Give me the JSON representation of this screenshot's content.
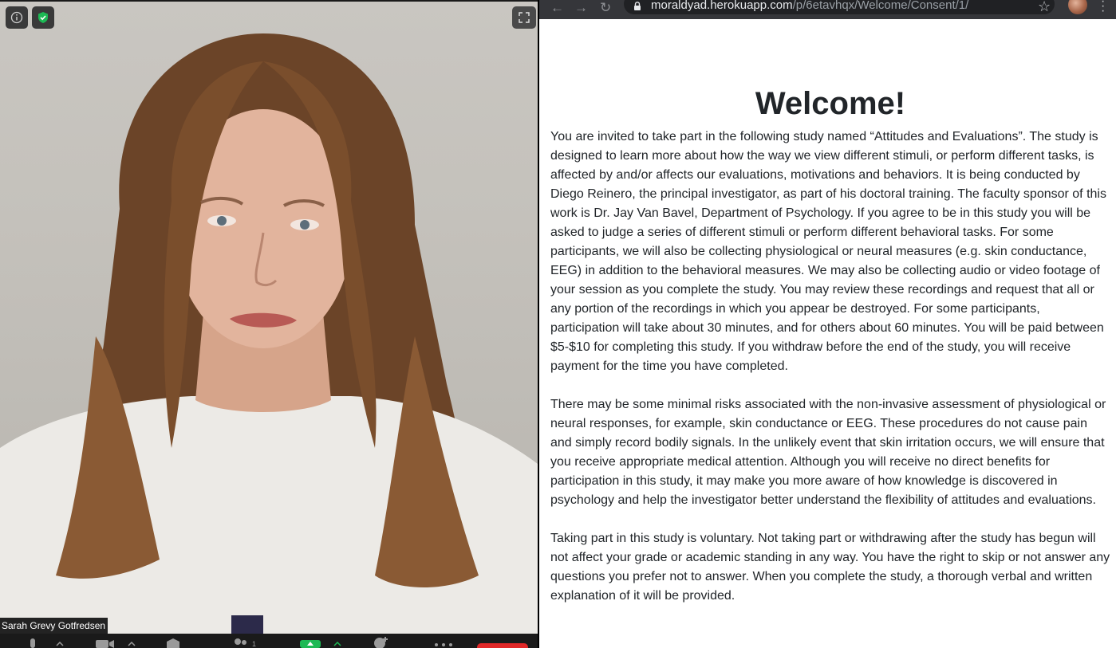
{
  "zoom": {
    "participant_name": "Sarah Grevy Gotfredsen",
    "icons": {
      "info": "info-icon",
      "security": "shield-check-icon",
      "fullscreen": "fullscreen-icon"
    },
    "colors": {
      "shield": "#1db954",
      "toolbar_bg": "#1a1a1a"
    },
    "toolbar": {
      "participants_count": "1"
    }
  },
  "browser": {
    "url_host": "moraldyad.herokuapp.com",
    "url_path": "/p/6etavhqx/Welcome/Consent/1/"
  },
  "page": {
    "title": "Welcome!",
    "paragraphs": [
      "You are invited to take part in the following study named “Attitudes and Evaluations”. The study is designed to learn more about how the way we view different stimuli, or perform different tasks, is affected by and/or affects our evaluations, motivations and behaviors. It is being conducted by Diego Reinero, the principal investigator, as part of his doctoral training. The faculty sponsor of this work is Dr. Jay Van Bavel, Department of Psychology. If you agree to be in this study you will be asked to judge a series of different stimuli or perform different behavioral tasks. For some participants, we will also be collecting physiological or neural measures (e.g. skin conductance, EEG) in addition to the behavioral measures. We may also be collecting audio or video footage of your session as you complete the study. You may review these recordings and request that all or any portion of the recordings in which you appear be destroyed. For some participants, participation will take about 30 minutes, and for others about 60 minutes. You will be paid between $5-$10 for completing this study. If you withdraw before the end of the study, you will receive payment for the time you have completed.",
      "There may be some minimal risks associated with the non-invasive assessment of physiological or neural responses, for example, skin conductance or EEG. These procedures do not cause pain and simply record bodily signals. In the unlikely event that skin irritation occurs, we will ensure that you receive appropriate medical attention. Although you will receive no direct benefits for participation in this study, it may make you more aware of how knowledge is discovered in psychology and help the investigator better understand the flexibility of attitudes and evaluations.",
      "Taking part in this study is voluntary. Not taking part or withdrawing after the study has begun will not affect your grade or academic standing in any way. You have the right to skip or not answer any questions you prefer not to answer. When you complete the study, a thorough verbal and written explanation of it will be provided."
    ]
  }
}
